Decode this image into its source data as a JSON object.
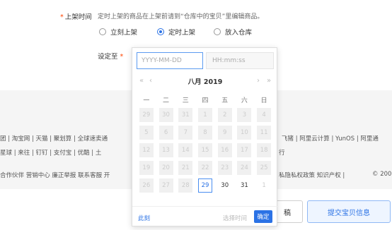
{
  "form": {
    "listing_time_label": "上架时间",
    "required_mark": "*",
    "hint": "定时上架的商品在上架前请到“仓库中的宝贝”里编辑商品。",
    "radio_options": [
      {
        "label": "立刻上架",
        "selected": false
      },
      {
        "label": "定时上架",
        "selected": true
      },
      {
        "label": "放入仓库",
        "selected": false
      }
    ],
    "set_label": "设定至"
  },
  "date_picker": {
    "date_placeholder": "YYYY-MM-DD",
    "time_placeholder": "HH:mm:ss",
    "title": "八月  2019",
    "nav": {
      "prev_year": "«",
      "prev_month": "‹",
      "next_month": "›",
      "next_year": "»"
    },
    "weekdays": [
      "一",
      "二",
      "三",
      "四",
      "五",
      "六",
      "日"
    ],
    "days": [
      {
        "d": "29",
        "s": "dis"
      },
      {
        "d": "30",
        "s": "dis"
      },
      {
        "d": "31",
        "s": "dis"
      },
      {
        "d": "1",
        "s": "dis"
      },
      {
        "d": "2",
        "s": "dis"
      },
      {
        "d": "3",
        "s": "dis"
      },
      {
        "d": "4",
        "s": "dis"
      },
      {
        "d": "5",
        "s": "dis"
      },
      {
        "d": "6",
        "s": "dis"
      },
      {
        "d": "7",
        "s": "dis"
      },
      {
        "d": "8",
        "s": "dis"
      },
      {
        "d": "9",
        "s": "dis"
      },
      {
        "d": "10",
        "s": "dis"
      },
      {
        "d": "11",
        "s": "dis"
      },
      {
        "d": "12",
        "s": "dis"
      },
      {
        "d": "13",
        "s": "dis"
      },
      {
        "d": "14",
        "s": "dis"
      },
      {
        "d": "15",
        "s": "dis"
      },
      {
        "d": "16",
        "s": "dis"
      },
      {
        "d": "17",
        "s": "dis"
      },
      {
        "d": "18",
        "s": "dis"
      },
      {
        "d": "19",
        "s": "dis"
      },
      {
        "d": "20",
        "s": "dis"
      },
      {
        "d": "21",
        "s": "dis"
      },
      {
        "d": "22",
        "s": "dis"
      },
      {
        "d": "23",
        "s": "dis"
      },
      {
        "d": "24",
        "s": "dis"
      },
      {
        "d": "25",
        "s": "dis"
      },
      {
        "d": "26",
        "s": "dis"
      },
      {
        "d": "27",
        "s": "dis"
      },
      {
        "d": "28",
        "s": "dis"
      },
      {
        "d": "29",
        "s": "sel"
      },
      {
        "d": "30",
        "s": "cur"
      },
      {
        "d": "31",
        "s": "cur"
      },
      {
        "d": "1",
        "s": "next"
      }
    ],
    "now_link": "此刻",
    "select_time": "选择时间",
    "ok": "确定"
  },
  "footer": {
    "line1": "团 | 淘宝网 | 天猫 | 聚划算 | 全球速卖通",
    "line1_right": "飞猪 | 阿里云计算 | YunOS | 阿里通",
    "line2": "星球 | 来往 | 钉钉 | 支付宝 | 优酷 | 土",
    "line2_right": "行",
    "line3": "合作伙伴  营销中心  廉正举报  联系客服  开",
    "line3_right": "私隐私权政策  知识产权  |",
    "copyright": "© 200"
  },
  "actions": {
    "left_button": "稿",
    "submit": "提交宝贝信息"
  },
  "colors": {
    "accent": "#2b72e5",
    "required": "#ff4400",
    "band": "#f5f5f5"
  }
}
